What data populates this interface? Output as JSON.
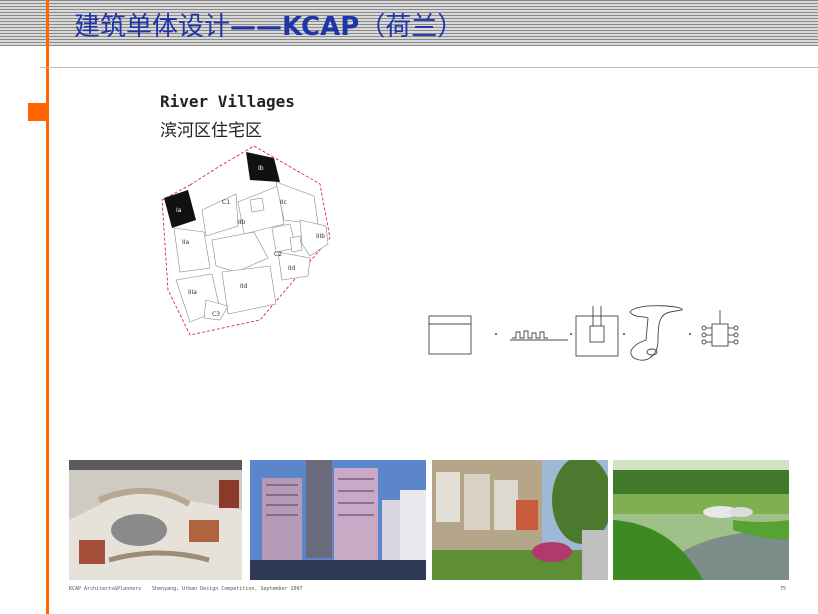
{
  "header": {
    "title_cn": "建筑单体设计",
    "title_en": "——KCAP",
    "title_paren": "（荷兰）"
  },
  "section": {
    "heading_en": "River Villages",
    "heading_zh": "滨河区住宅区"
  },
  "map": {
    "labels": [
      "Ia",
      "Ib",
      "C1",
      "IIb",
      "IIc",
      "IIa",
      "IIIb",
      "C2",
      "IId",
      "IIIa",
      "IId",
      "C3"
    ]
  },
  "photos": [
    {
      "name": "model-photo"
    },
    {
      "name": "building-photo"
    },
    {
      "name": "street-photo"
    },
    {
      "name": "waterside-photo"
    }
  ],
  "footer": {
    "left": "KCAP Architects&Planners",
    "center": "Shenyang, Urban Design Competition, September 2007",
    "right": "75"
  }
}
